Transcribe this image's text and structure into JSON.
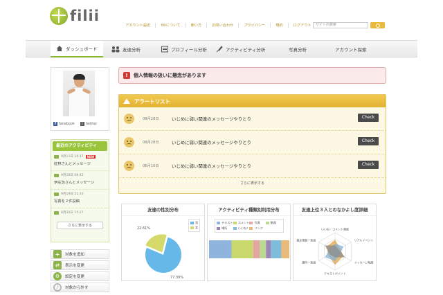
{
  "brand": {
    "name": "filii"
  },
  "top_links": [
    "アカウント設定",
    "filiiについて",
    "使い方",
    "お問い合わせ",
    "プライバシー",
    "規約",
    "ログアウト"
  ],
  "search": {
    "placeholder": "サイト内検索"
  },
  "nav": {
    "items": [
      {
        "label": "ダッシュボード",
        "icon": "home-icon",
        "active": true
      },
      {
        "label": "友達分析",
        "icon": "people-icon"
      },
      {
        "label": "プロフィール分析",
        "icon": "profile-card-icon"
      },
      {
        "label": "アクティビティ分析",
        "icon": "rocket-icon"
      },
      {
        "label": "写真分析",
        "icon": ""
      },
      {
        "label": "アカウント探索",
        "icon": ""
      }
    ]
  },
  "sidebar": {
    "social": {
      "facebook": "facebook",
      "twitter": "twitter"
    },
    "recent_activity": {
      "title": "最近のアクティビティ",
      "items": [
        {
          "date": "9月11日 16:17",
          "text": "紅林さんとメッセージ",
          "new": "NEW"
        },
        {
          "date": "9月18日 08:42",
          "text": "伊左治さんとメッセージ"
        },
        {
          "date": "9月19日 21:33",
          "text": "写真を２件投稿"
        },
        {
          "date": "8月30日 15:27",
          "text": ""
        }
      ],
      "more": "さらに表示する"
    },
    "actions": [
      {
        "label": "対象を追加",
        "icon": "plus-icon",
        "color": "#8cb34a"
      },
      {
        "label": "表示を変更",
        "icon": "arrows-icon",
        "color": "#8cb34a"
      },
      {
        "label": "設定を変更",
        "icon": "gear-icon",
        "color": "#8cb34a"
      },
      {
        "label": "対象から外す",
        "icon": "prohibit-icon",
        "color": "#b8b8b8"
      }
    ]
  },
  "main": {
    "alert_banner": {
      "badge": "!",
      "text": "個人情報の扱いに懸念があります"
    },
    "alert_list": {
      "title": "アラートリスト",
      "rows": [
        {
          "date": "08月28日",
          "text": "いじめに弱い関連のメッセージやりとり",
          "button": "Check"
        },
        {
          "date": "08月28日",
          "text": "いじめに弱い関連のメッセージやりとり",
          "button": "Check"
        },
        {
          "date": "06月10日",
          "text": "いじめに弱い関連のメッセージやりとり",
          "button": "Check"
        }
      ],
      "more": "さらに表示する"
    },
    "panels": {
      "gender": {
        "title": "友達の性別分布",
        "legend": [
          "男",
          "女"
        ]
      },
      "activity": {
        "title": "アクティビティ種類別利用分布",
        "legend": [
          "テキスト",
          "コメント",
          "写真",
          "動画",
          "場所",
          "いいね！",
          "リンク"
        ]
      },
      "radar": {
        "title": "友達上位３人とのなかよし度詳細",
        "axes": [
          "いいね・コメント頻度",
          "リアルイベント",
          "メッセージ頻度",
          "テキストポイント",
          "趣向一致度",
          "基本情報一致度"
        ]
      }
    }
  },
  "colors": {
    "accent_green": "#8ab533",
    "alert_red": "#cc3b35",
    "alert_gold": "#e3b232"
  },
  "chart_data": [
    {
      "type": "pie",
      "categories": [
        "男",
        "女"
      ],
      "values": [
        77.39,
        22.61
      ],
      "labels": [
        "77.39%",
        "22.61%"
      ],
      "colors": [
        "#66b8e8",
        "#d4d96a"
      ],
      "title": "友達の性別分布",
      "legend": "top-right"
    },
    {
      "type": "bar",
      "stacked": true,
      "categories": [
        "テキスト",
        "コメント",
        "写真",
        "動画",
        "場所",
        "いいね！",
        "リンク"
      ],
      "values": [
        28,
        27,
        8,
        8,
        6,
        13,
        10
      ],
      "colors": [
        "#8fb5de",
        "#c9d86c",
        "#e5a5a5",
        "#bcd78f",
        "#9c86b8",
        "#7fbcd9",
        "#e9b97a"
      ],
      "title": "アクティビティ種類別利用分布",
      "legend": "top"
    },
    {
      "type": "radar",
      "axes": [
        "いいね・コメント頻度",
        "リアルイベント",
        "メッセージ頻度",
        "テキストポイント",
        "趣向一致度",
        "基本情報一致度"
      ],
      "series": [
        {
          "values": [
            0.6,
            0.3,
            0.5,
            0.7,
            0.4,
            0.5
          ],
          "color": "#e0a03a"
        },
        {
          "values": [
            0.4,
            0.5,
            0.3,
            0.5,
            0.6,
            0.3
          ],
          "color": "#7fb2d8"
        },
        {
          "values": [
            0.3,
            0.2,
            0.6,
            0.3,
            0.3,
            0.6
          ],
          "color": "#8a8a8a"
        }
      ],
      "title": "友達上位３人とのなかよし度詳細"
    }
  ]
}
